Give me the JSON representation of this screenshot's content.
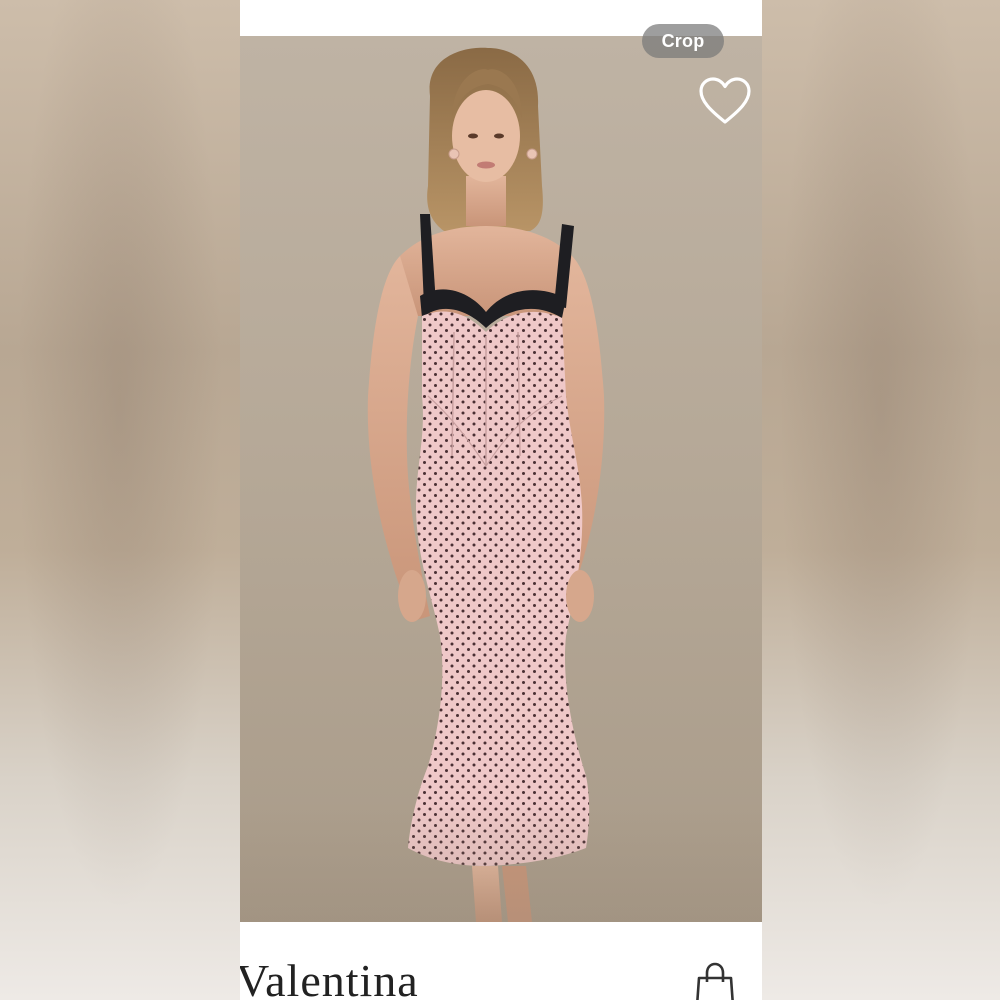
{
  "toolbar": {
    "crop_label": "Crop"
  },
  "product": {
    "name": "Valentina"
  },
  "icons": {
    "favorite": "heart-icon",
    "cart": "shopping-bag-icon"
  },
  "colors": {
    "dress_pink": "#efc8c8",
    "polka_dot": "#4a2f33",
    "strap_black": "#1e1e22",
    "backdrop": "#b6a998"
  }
}
